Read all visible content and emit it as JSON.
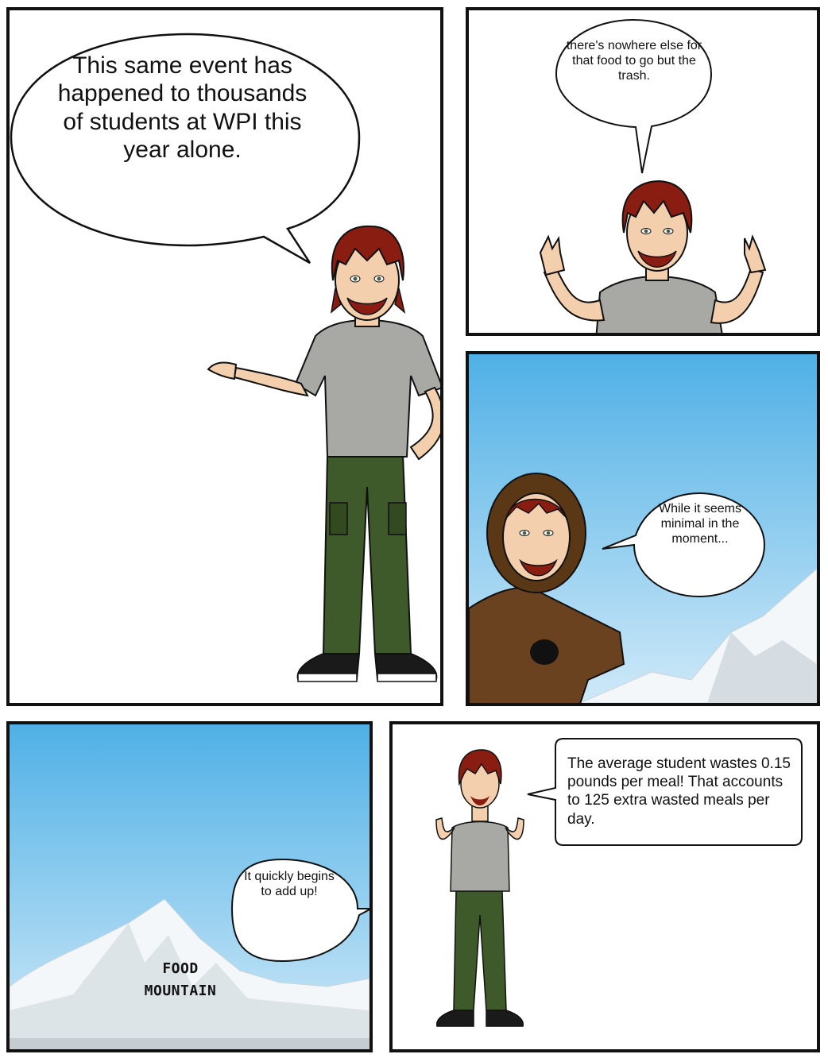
{
  "panels": {
    "p1": {
      "speech": "This same event has happened to thousands of students at WPI this year alone."
    },
    "p2": {
      "speech": "there's nowhere else for that food to go but the trash."
    },
    "p3": {
      "speech": "While it seems minimal in the moment..."
    },
    "p4": {
      "speech": "It quickly begins to add up!",
      "mountain_label_1": "FOOD",
      "mountain_label_2": "MOUNTAIN"
    },
    "p5": {
      "speech": "The average student wastes 0.15 pounds per meal! That accounts to 125 extra wasted meals per day."
    }
  },
  "colors": {
    "sky_top": "#4fb0e6",
    "sky_bottom": "#cfe9f8",
    "hair": "#8a1d12",
    "shirt": "#a8a8a4",
    "pants": "#3f5a2a",
    "skin": "#f3cfae",
    "coat": "#6b4220",
    "fur": "#5a3816"
  }
}
